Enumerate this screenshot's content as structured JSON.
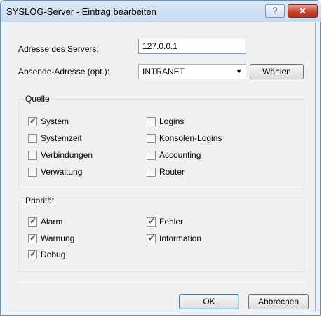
{
  "window": {
    "title": "SYSLOG-Server - Eintrag bearbeiten",
    "help_glyph": "?",
    "close_glyph": "✕"
  },
  "form": {
    "server_label": "Adresse des Servers:",
    "server_value": "127.0.0.1",
    "sender_label": "Absende-Adresse (opt.):",
    "sender_value": "INTRANET",
    "choose_label": "Wählen"
  },
  "source": {
    "title": "Quelle",
    "items": [
      {
        "label": "System",
        "checked": true
      },
      {
        "label": "Systemzeit",
        "checked": false
      },
      {
        "label": "Verbindungen",
        "checked": false
      },
      {
        "label": "Verwaltung",
        "checked": false
      },
      {
        "label": "Logins",
        "checked": false
      },
      {
        "label": "Konsolen-Logins",
        "checked": false
      },
      {
        "label": "Accounting",
        "checked": false
      },
      {
        "label": "Router",
        "checked": false
      }
    ]
  },
  "priority": {
    "title": "Priorität",
    "items": [
      {
        "label": "Alarm",
        "checked": true
      },
      {
        "label": "Warnung",
        "checked": true
      },
      {
        "label": "Debug",
        "checked": true
      },
      {
        "label": "Fehler",
        "checked": true
      },
      {
        "label": "Information",
        "checked": true
      }
    ]
  },
  "buttons": {
    "ok": "OK",
    "cancel": "Abbrechen"
  }
}
